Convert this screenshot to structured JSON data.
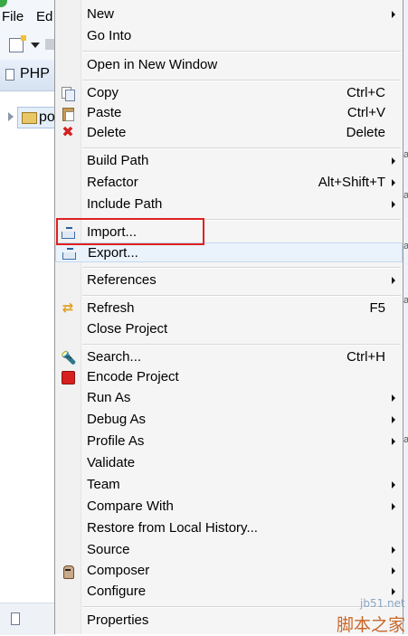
{
  "ide": {
    "menubar": [
      "File",
      "Ed"
    ],
    "view_tab_label": "PHP E",
    "tree_node_label": "po",
    "right_fragments": [
      "a",
      "a",
      "a",
      "a",
      "a"
    ]
  },
  "context_menu": {
    "items": [
      {
        "label": "New",
        "accel": "",
        "submenu": true,
        "icon": ""
      },
      {
        "label": "Go Into",
        "accel": "",
        "submenu": false,
        "icon": ""
      },
      {
        "label": "Open in New Window",
        "accel": "",
        "submenu": false,
        "icon": ""
      },
      {
        "label": "Copy",
        "accel": "Ctrl+C",
        "submenu": false,
        "icon": "copy-icon"
      },
      {
        "label": "Paste",
        "accel": "Ctrl+V",
        "submenu": false,
        "icon": "paste-icon"
      },
      {
        "label": "Delete",
        "accel": "Delete",
        "submenu": false,
        "icon": "delete-icon"
      },
      {
        "label": "Build Path",
        "accel": "",
        "submenu": true,
        "icon": ""
      },
      {
        "label": "Refactor",
        "accel": "Alt+Shift+T",
        "submenu": true,
        "icon": ""
      },
      {
        "label": "Include Path",
        "accel": "",
        "submenu": true,
        "icon": ""
      },
      {
        "label": "Import...",
        "accel": "",
        "submenu": false,
        "icon": "import-icon"
      },
      {
        "label": "Export...",
        "accel": "",
        "submenu": false,
        "icon": "export-icon",
        "hovered": true
      },
      {
        "label": "References",
        "accel": "",
        "submenu": true,
        "icon": ""
      },
      {
        "label": "Refresh",
        "accel": "F5",
        "submenu": false,
        "icon": "refresh-icon"
      },
      {
        "label": "Close Project",
        "accel": "",
        "submenu": false,
        "icon": ""
      },
      {
        "label": "Search...",
        "accel": "Ctrl+H",
        "submenu": false,
        "icon": "search-icon"
      },
      {
        "label": "Encode Project",
        "accel": "",
        "submenu": false,
        "icon": "encode-icon"
      },
      {
        "label": "Run As",
        "accel": "",
        "submenu": true,
        "icon": ""
      },
      {
        "label": "Debug As",
        "accel": "",
        "submenu": true,
        "icon": ""
      },
      {
        "label": "Profile As",
        "accel": "",
        "submenu": true,
        "icon": ""
      },
      {
        "label": "Validate",
        "accel": "",
        "submenu": false,
        "icon": ""
      },
      {
        "label": "Team",
        "accel": "",
        "submenu": true,
        "icon": ""
      },
      {
        "label": "Compare With",
        "accel": "",
        "submenu": true,
        "icon": ""
      },
      {
        "label": "Restore from Local History...",
        "accel": "",
        "submenu": false,
        "icon": ""
      },
      {
        "label": "Source",
        "accel": "",
        "submenu": true,
        "icon": ""
      },
      {
        "label": "Composer",
        "accel": "",
        "submenu": true,
        "icon": "composer-icon"
      },
      {
        "label": "Configure",
        "accel": "",
        "submenu": true,
        "icon": ""
      },
      {
        "label": "Properties",
        "accel": "",
        "submenu": false,
        "icon": ""
      }
    ]
  },
  "watermark": {
    "site": "jb51.net",
    "name": "脚本之家"
  },
  "colors": {
    "highlight_box": "#e02020",
    "hover_bg": "#eaf2fb"
  }
}
